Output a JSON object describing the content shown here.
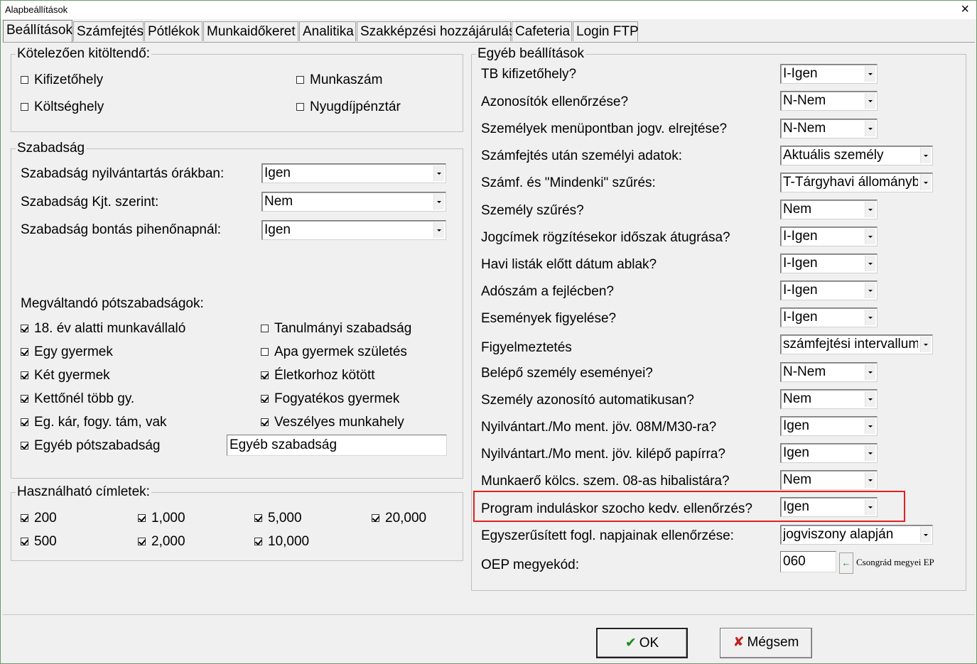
{
  "window": {
    "title": "Alapbeállítások",
    "close_glyph": "×"
  },
  "tabs": [
    {
      "label": "Beállítások",
      "active": true
    },
    {
      "label": "Számfejtés"
    },
    {
      "label": "Pótlékok"
    },
    {
      "label": "Munkaidőkeret"
    },
    {
      "label": "Analitika"
    },
    {
      "label": "Szakképzési hozzájárulás"
    },
    {
      "label": "Cafeteria"
    },
    {
      "label": "Login FTP"
    }
  ],
  "required": {
    "title": "Kötelezően kitöltendő:",
    "items": [
      {
        "label": "Kifizetőhely",
        "checked": false
      },
      {
        "label": "Munkaszám",
        "checked": false
      },
      {
        "label": "Költséghely",
        "checked": false
      },
      {
        "label": "Nyugdíjpénztár",
        "checked": false
      }
    ]
  },
  "leave": {
    "title": "Szabadság",
    "fields": [
      {
        "label": "Szabadság nyilvántartás órákban:",
        "value": "Igen"
      },
      {
        "label": "Szabadság Kjt. szerint:",
        "value": "Nem"
      },
      {
        "label": "Szabadság bontás pihenőnapnál:",
        "value": "Igen"
      }
    ],
    "extra_title": "Megváltandó pótszabadságok:",
    "extra_items": [
      {
        "label": "18. év alatti munkavállaló",
        "checked": true
      },
      {
        "label": "Tanulmányi szabadság",
        "checked": false
      },
      {
        "label": "Egy gyermek",
        "checked": true
      },
      {
        "label": "Apa gyermek születés",
        "checked": false
      },
      {
        "label": "Két gyermek",
        "checked": true
      },
      {
        "label": "Életkorhoz kötött",
        "checked": true
      },
      {
        "label": "Kettőnél több gy.",
        "checked": true
      },
      {
        "label": "Fogyatékos gyermek",
        "checked": true
      },
      {
        "label": "Eg. kár, fogy. tám, vak",
        "checked": true
      },
      {
        "label": "Veszélyes munkahely",
        "checked": true
      },
      {
        "label": "Egyéb pótszabadság",
        "checked": true
      }
    ],
    "other_leave_value": "Egyéb szabadság"
  },
  "denominations": {
    "title": "Használható címletek:",
    "items": [
      {
        "label": "200",
        "checked": true
      },
      {
        "label": "1,000",
        "checked": true
      },
      {
        "label": "5,000",
        "checked": true
      },
      {
        "label": "20,000",
        "checked": true
      },
      {
        "label": "500",
        "checked": true
      },
      {
        "label": "2,000",
        "checked": true
      },
      {
        "label": "10,000",
        "checked": true
      }
    ]
  },
  "other": {
    "title": "Egyéb beállítások",
    "rows": [
      {
        "label": "TB kifizetőhely?",
        "value": "I-Igen"
      },
      {
        "label": "Azonosítók ellenőrzése?",
        "value": "N-Nem"
      },
      {
        "label": "Személyek menüpontban jogv. elrejtése?",
        "value": "N-Nem"
      },
      {
        "label": "Számfejtés után személyi adatok:",
        "value": "Aktuális személy"
      },
      {
        "label": "Számf. és \"Mindenki\" szűrés:",
        "value": "T-Tárgyhavi állományba"
      },
      {
        "label": "Személy szűrés?",
        "value": "Nem"
      },
      {
        "label": "Jogcímek rögzítésekor időszak átugrása?",
        "value": "I-Igen"
      },
      {
        "label": "Havi listák előtt dátum ablak?",
        "value": "I-Igen"
      },
      {
        "label": "Adószám a fejlécben?",
        "value": "I-Igen"
      },
      {
        "label": "Események figyelése?",
        "value": "I-Igen"
      },
      {
        "label": "Figyelmeztetés",
        "value": "számfejtési intervallum"
      },
      {
        "label": "Belépő személy eseményei?",
        "value": "N-Nem"
      },
      {
        "label": "Személy azonosító automatikusan?",
        "value": "Nem"
      },
      {
        "label": "Nyilvántart./Mo ment. jöv. 08M/M30-ra?",
        "value": "Igen"
      },
      {
        "label": "Nyilvántart./Mo ment. jöv. kilépő papírra?",
        "value": "Igen"
      },
      {
        "label": "Munkaerő kölcs. szem. 08-as hibalistára?",
        "value": "Nem"
      },
      {
        "label": "Program induláskor szocho kedv. ellenőrzés?",
        "value": "Igen"
      },
      {
        "label": "Egyszerűsített fogl. napjainak ellenőrzése:",
        "value": "jogviszony alapján"
      }
    ],
    "oep_label": "OEP megyekód:",
    "oep_value": "060",
    "oep_button_glyph": "←",
    "oep_name": "Csongrád megyei EP"
  },
  "buttons": {
    "ok_label": "OK",
    "ok_icon": "✔",
    "cancel_label": "Mégsem",
    "cancel_icon": "✘"
  },
  "colors": {
    "highlight": "#e02020",
    "ok_icon": "#1a8a1a",
    "cancel_icon": "#c02020"
  }
}
